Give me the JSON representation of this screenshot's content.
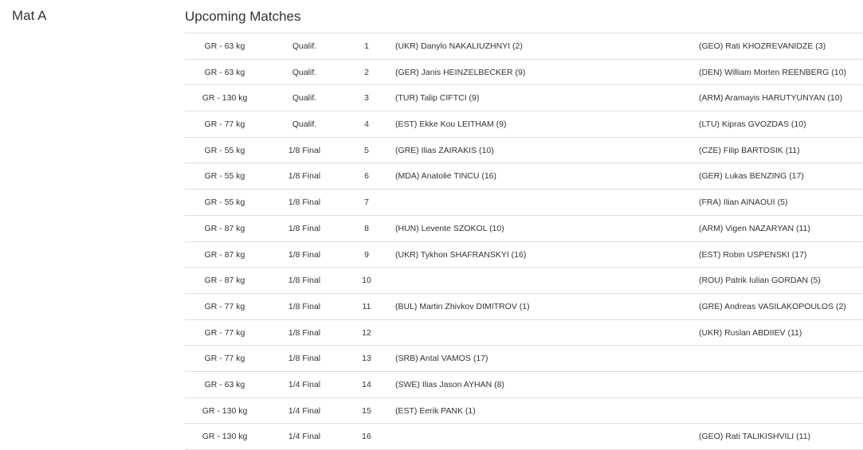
{
  "mat": {
    "title": "Mat A"
  },
  "upcoming": {
    "title": "Upcoming Matches",
    "rows": [
      {
        "weight": "GR - 63 kg",
        "round": "Qualif.",
        "number": "1",
        "red": "(UKR) Danylo NAKALIUZHNYI (2)",
        "blue": "(GEO) Rati KHOZREVANIDZE (3)"
      },
      {
        "weight": "GR - 63 kg",
        "round": "Qualif.",
        "number": "2",
        "red": "(GER) Janis HEINZELBECKER (9)",
        "blue": "(DEN) William Morten REENBERG (10)"
      },
      {
        "weight": "GR - 130 kg",
        "round": "Qualif.",
        "number": "3",
        "red": "(TUR) Talip CIFTCI (9)",
        "blue": "(ARM) Aramayis HARUTYUNYAN (10)"
      },
      {
        "weight": "GR - 77 kg",
        "round": "Qualif.",
        "number": "4",
        "red": "(EST) Ekke Kou LEITHAM (9)",
        "blue": "(LTU) Kipras GVOZDAS (10)"
      },
      {
        "weight": "GR - 55 kg",
        "round": "1/8 Final",
        "number": "5",
        "red": "(GRE) Ilias ZAIRAKIS (10)",
        "blue": "(CZE) Filip BARTOSIK (11)"
      },
      {
        "weight": "GR - 55 kg",
        "round": "1/8 Final",
        "number": "6",
        "red": "(MDA) Anatolie TINCU (16)",
        "blue": "(GER) Lukas BENZING (17)"
      },
      {
        "weight": "GR - 55 kg",
        "round": "1/8 Final",
        "number": "7",
        "red": "",
        "blue": "(FRA) Ilian AINAOUI (5)"
      },
      {
        "weight": "GR - 87 kg",
        "round": "1/8 Final",
        "number": "8",
        "red": "(HUN) Levente SZOKOL (10)",
        "blue": "(ARM) Vigen NAZARYAN (11)"
      },
      {
        "weight": "GR - 87 kg",
        "round": "1/8 Final",
        "number": "9",
        "red": "(UKR) Tykhon SHAFRANSKYI (16)",
        "blue": "(EST) Robin USPENSKI (17)"
      },
      {
        "weight": "GR - 87 kg",
        "round": "1/8 Final",
        "number": "10",
        "red": "",
        "blue": "(ROU) Patrik Iulian GORDAN (5)"
      },
      {
        "weight": "GR - 77 kg",
        "round": "1/8 Final",
        "number": "11",
        "red": "(BUL) Martin Zhivkov DIMITROV (1)",
        "blue": "(GRE) Andreas VASILAKOPOULOS (2)"
      },
      {
        "weight": "GR - 77 kg",
        "round": "1/8 Final",
        "number": "12",
        "red": "",
        "blue": "(UKR) Ruslan ABDIIEV (11)"
      },
      {
        "weight": "GR - 77 kg",
        "round": "1/8 Final",
        "number": "13",
        "red": "(SRB) Antal VAMOS (17)",
        "blue": ""
      },
      {
        "weight": "GR - 63 kg",
        "round": "1/4 Final",
        "number": "14",
        "red": "(SWE) Ilias Jason AYHAN (8)",
        "blue": ""
      },
      {
        "weight": "GR - 130 kg",
        "round": "1/4 Final",
        "number": "15",
        "red": "(EST) Eerik PANK (1)",
        "blue": ""
      },
      {
        "weight": "GR - 130 kg",
        "round": "1/4 Final",
        "number": "16",
        "red": "",
        "blue": "(GEO) Rati TALIKISHVILI (11)"
      }
    ]
  }
}
